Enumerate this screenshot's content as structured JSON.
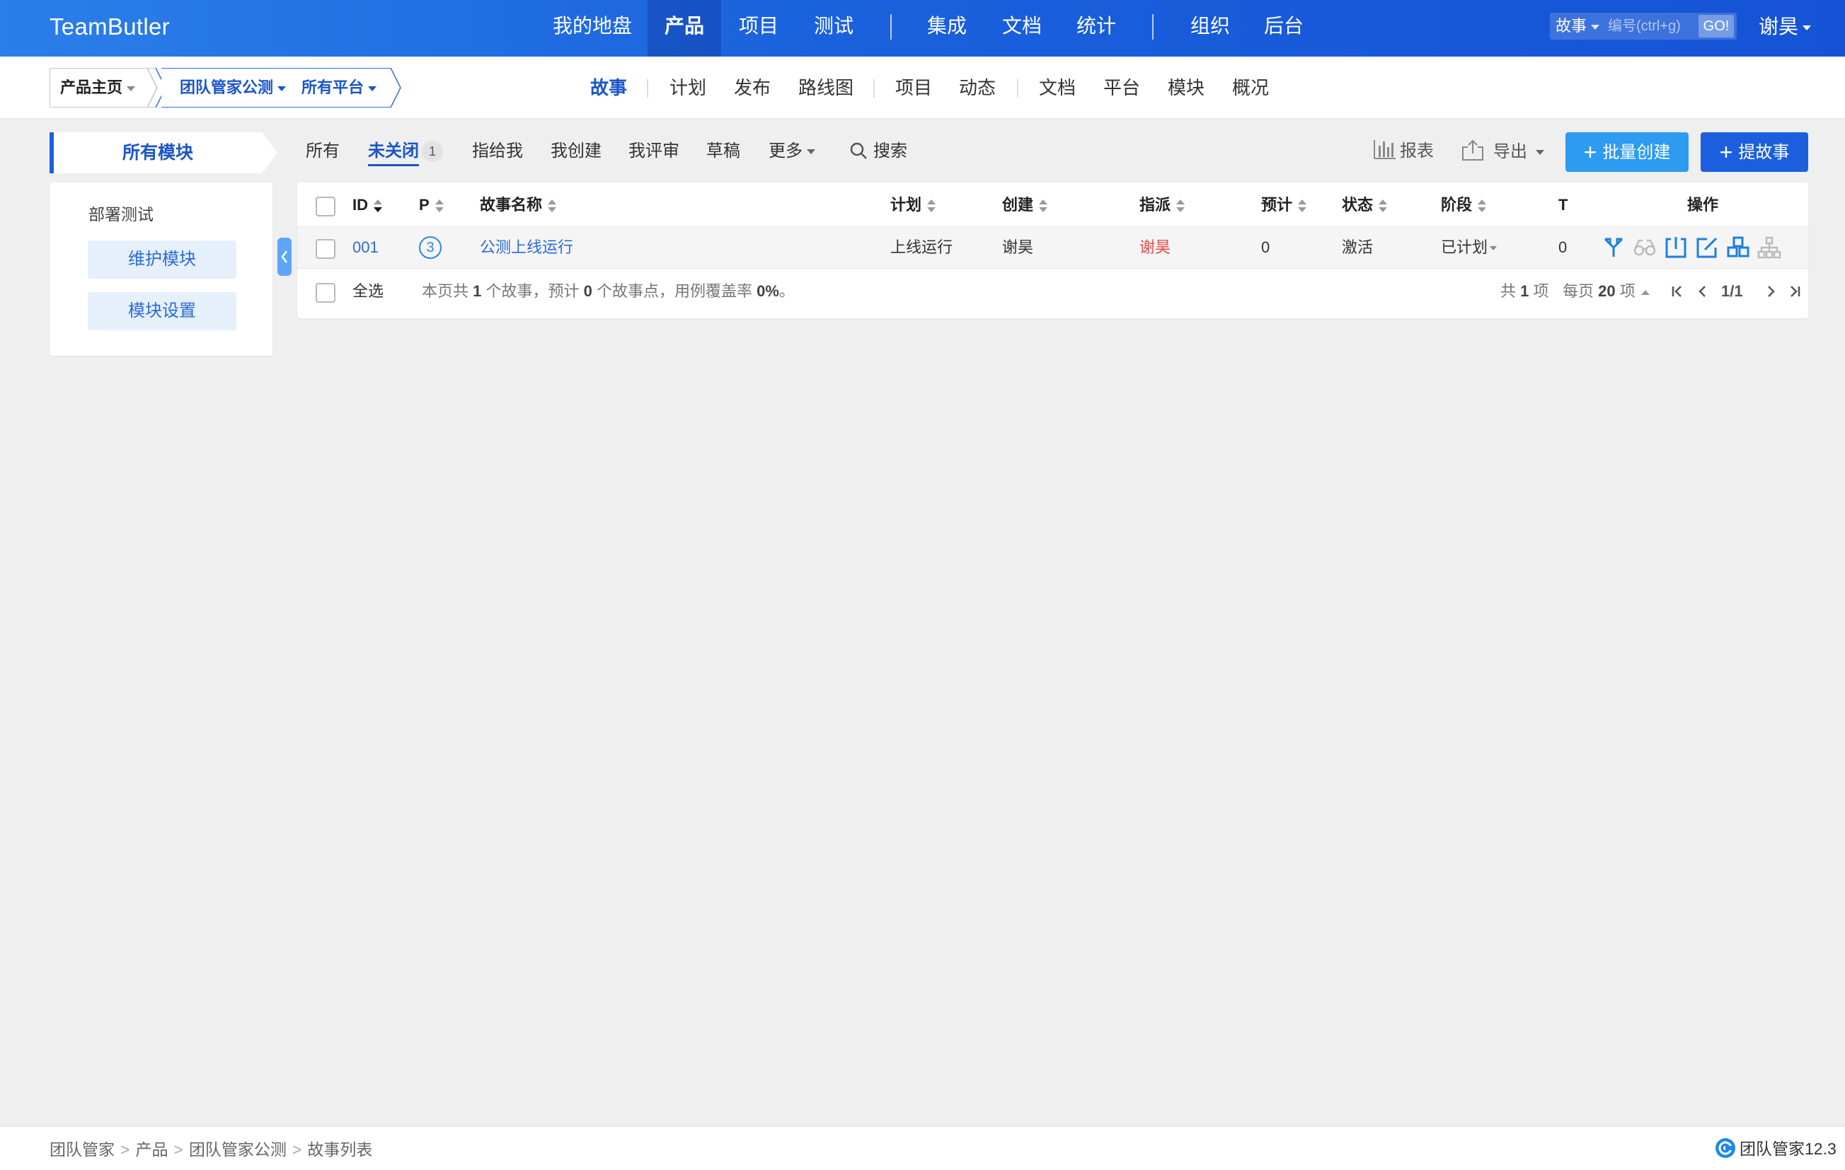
{
  "header": {
    "brand": "TeamButler",
    "nav": [
      {
        "label": "我的地盘"
      },
      {
        "label": "产品",
        "active": true
      },
      {
        "label": "项目"
      },
      {
        "label": "测试"
      },
      {
        "label": "集成"
      },
      {
        "label": "文档"
      },
      {
        "label": "统计"
      },
      {
        "label": "组织"
      },
      {
        "label": "后台"
      }
    ],
    "quick_type": "故事",
    "quick_placeholder": "编号(ctrl+g)",
    "quick_go": "GO!",
    "user": "谢昊"
  },
  "subbar": {
    "crumb_home": "产品主页",
    "crumb_product": "团队管家公测",
    "crumb_platform": "所有平台",
    "tabs": [
      {
        "label": "故事",
        "active": true
      },
      {
        "label": "计划"
      },
      {
        "label": "发布"
      },
      {
        "label": "路线图"
      },
      {
        "label": "项目"
      },
      {
        "label": "动态"
      },
      {
        "label": "文档"
      },
      {
        "label": "平台"
      },
      {
        "label": "模块"
      },
      {
        "label": "概况"
      }
    ]
  },
  "sidebar": {
    "title": "所有模块",
    "group": "部署测试",
    "buttons": [
      "维护模块",
      "模块设置"
    ]
  },
  "filters": {
    "items": [
      "所有",
      "未关闭",
      "指给我",
      "我创建",
      "我评审",
      "草稿",
      "更多"
    ],
    "active": "未关闭",
    "unclosed_count": "1",
    "search": "搜索",
    "report": "报表",
    "export": "导出",
    "batch_create": "批量创建",
    "create_story": "提故事"
  },
  "table": {
    "columns": {
      "id": "ID",
      "pri": "P",
      "name": "故事名称",
      "plan": "计划",
      "creator": "创建",
      "assigned": "指派",
      "estimate": "预计",
      "status": "状态",
      "stage": "阶段",
      "t": "T",
      "actions": "操作"
    },
    "rows": [
      {
        "id": "001",
        "pri": "3",
        "name": "公测上线运行",
        "plan": "上线运行",
        "creator": "谢昊",
        "assigned": "谢昊",
        "estimate": "0",
        "status": "激活",
        "stage": "已计划",
        "t": "0"
      }
    ],
    "footer": {
      "select_all": "全选",
      "summary_prefix": "本页共 ",
      "summary_count": "1",
      "summary_mid": " 个故事，预计 ",
      "summary_points": "0",
      "summary_mid2": " 个故事点，用例覆盖率 ",
      "summary_coverage": "0%",
      "summary_suffix": "。",
      "total_prefix": "共 ",
      "total": "1",
      "total_suffix": " 项",
      "per_page_prefix": "每页 ",
      "per_page": "20",
      "per_page_suffix": " 项",
      "page": "1/1"
    }
  },
  "bottom": {
    "breadcrumb": [
      "团队管家",
      "产品",
      "团队管家公测",
      "故事列表"
    ],
    "version": "团队管家12.3"
  },
  "colors": {
    "brand_blue": "#1b5fde",
    "accent_blue": "#2d9bf0",
    "assigned_red": "#e64a4a"
  }
}
